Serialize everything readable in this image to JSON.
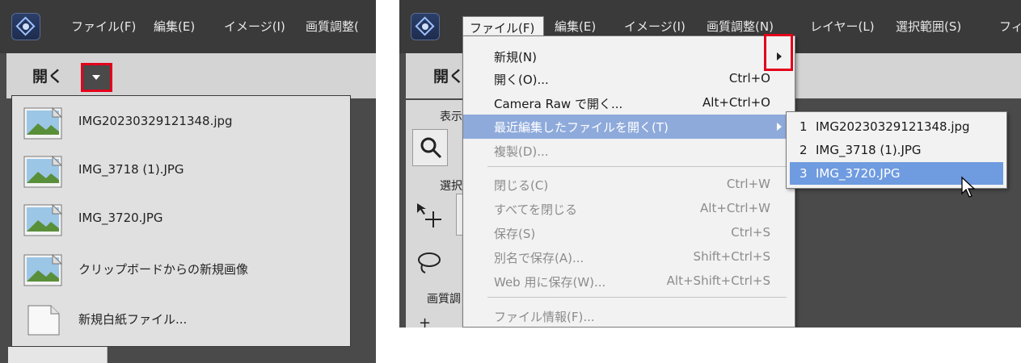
{
  "menubar": {
    "items": [
      "ファイル(F)",
      "編集(E)",
      "イメージ(I)",
      "画質調整(N)",
      "レイヤー(L)",
      "選択範囲(S)",
      "フィル"
    ],
    "left_partial_last": "画質調整(",
    "right_partial_last": "フィル"
  },
  "left_panel": {
    "open_label": "開く",
    "dropdown_icon": "triangle-down-icon",
    "recent_items": [
      {
        "label": "IMG20230329121348.jpg",
        "icon": "image-file-icon"
      },
      {
        "label": "IMG_3718 (1).JPG",
        "icon": "image-file-icon"
      },
      {
        "label": "IMG_3720.JPG",
        "icon": "image-file-icon"
      },
      {
        "label": "クリップボードからの新規画像",
        "icon": "image-file-icon"
      },
      {
        "label": "新規白紙ファイル...",
        "icon": "blank-file-icon"
      }
    ]
  },
  "right_panel": {
    "open_label": "開く",
    "tool_labels": {
      "view": "表示",
      "select": "選択",
      "quality": "画質調"
    },
    "file_menu_header": "ファイル(F)",
    "file_menu": [
      {
        "label": "新規(N)",
        "shortcut": "",
        "enabled": true,
        "submenu": true
      },
      {
        "label": "開く(O)...",
        "shortcut": "Ctrl+O",
        "enabled": true
      },
      {
        "label": "Camera Raw で開く...",
        "shortcut": "Alt+Ctrl+O",
        "enabled": true
      },
      {
        "label": "最近編集したファイルを開く(T)",
        "shortcut": "",
        "enabled": true,
        "submenu": true,
        "highlighted": true
      },
      {
        "label": "複製(D)...",
        "shortcut": "",
        "enabled": false
      },
      {
        "label": "閉じる(C)",
        "shortcut": "Ctrl+W",
        "enabled": false
      },
      {
        "label": "すべてを閉じる",
        "shortcut": "Alt+Ctrl+W",
        "enabled": false
      },
      {
        "label": "保存(S)",
        "shortcut": "Ctrl+S",
        "enabled": false
      },
      {
        "label": "別名で保存(A)...",
        "shortcut": "Shift+Ctrl+S",
        "enabled": false
      },
      {
        "label": "Web 用に保存(W)...",
        "shortcut": "Alt+Shift+Ctrl+S",
        "enabled": false
      },
      {
        "label": "ファイル情報(F)...",
        "shortcut": "",
        "enabled": false
      }
    ],
    "recent_submenu": [
      {
        "num": "1",
        "label": "IMG20230329121348.jpg"
      },
      {
        "num": "2",
        "label": "IMG_3718 (1).JPG"
      },
      {
        "num": "3",
        "label": "IMG_3720.JPG",
        "highlighted": true
      }
    ]
  },
  "colors": {
    "highlight_blue": "#8eaadb",
    "submenu_highlight": "#6f9be0",
    "red_callout": "#e3001b",
    "menubar_bg": "#3a3a3a"
  }
}
